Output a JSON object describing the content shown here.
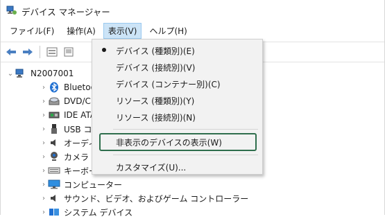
{
  "window": {
    "title": "デバイス マネージャー"
  },
  "menubar": {
    "items": [
      {
        "label": "ファイル(F)"
      },
      {
        "label": "操作(A)"
      },
      {
        "label": "表示(V)"
      },
      {
        "label": "ヘルプ(H)"
      }
    ]
  },
  "tree": {
    "root": {
      "label": "N2007001"
    },
    "children": [
      {
        "label": "Bluetooth",
        "icon": "bluetooth-icon"
      },
      {
        "label": "DVD/CD-R",
        "icon": "dvd-drive-icon"
      },
      {
        "label": "IDE ATA/A",
        "icon": "ide-controller-icon"
      },
      {
        "label": "USB コネク",
        "icon": "usb-icon"
      },
      {
        "label": "オーディオの",
        "icon": "audio-icon"
      },
      {
        "label": "カメラ",
        "icon": "camera-icon"
      },
      {
        "label": "キーボード",
        "icon": "keyboard-icon"
      },
      {
        "label": "コンピューター",
        "icon": "computer-icon"
      },
      {
        "label": "サウンド、ビデオ、およびゲーム コントローラー",
        "icon": "sound-icon"
      },
      {
        "label": "システム デバイス",
        "icon": "system-devices-icon"
      }
    ]
  },
  "view_menu": {
    "items": [
      {
        "label": "デバイス (種類別)(E)",
        "checked": true
      },
      {
        "label": "デバイス (接続別)(V)"
      },
      {
        "label": "デバイス (コンテナー別)(C)"
      },
      {
        "label": "リソース (種類別)(Y)"
      },
      {
        "label": "リソース (接続別)(N)"
      }
    ],
    "show_hidden": {
      "label": "非表示のデバイスの表示(W)"
    },
    "customize": {
      "label": "カスタマイズ(U)..."
    }
  },
  "colors": {
    "menu_active": "#cce4f7",
    "highlight_border": "#2e6e4c"
  }
}
